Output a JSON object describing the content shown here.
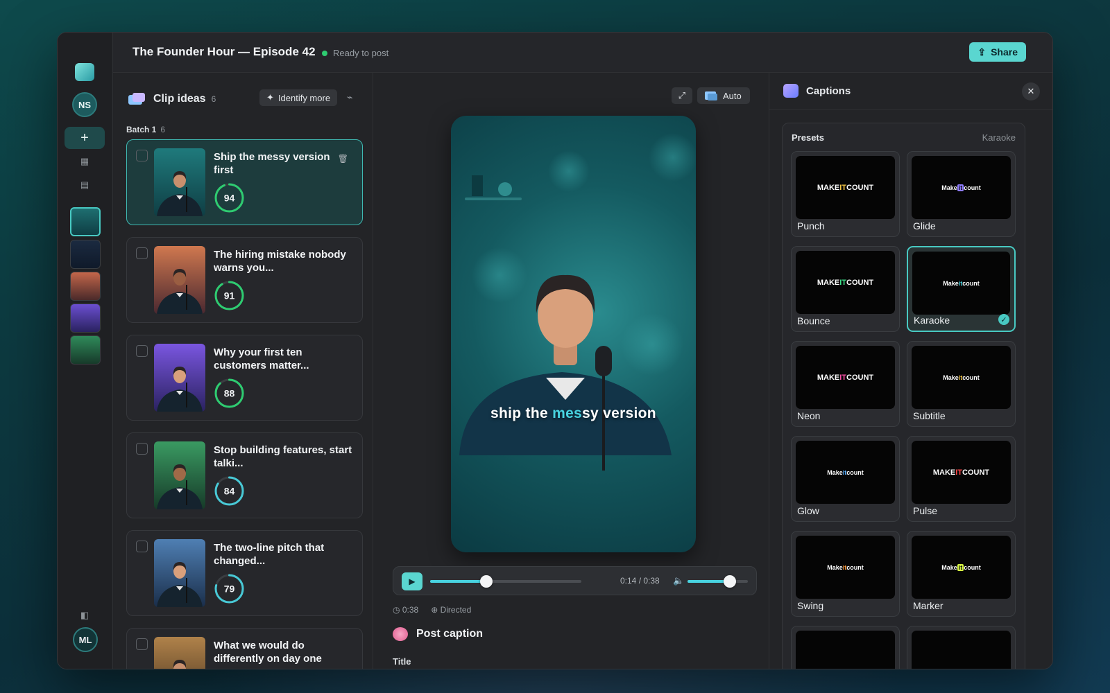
{
  "window": {
    "title": "The Founder Hour — Episode 42",
    "status": "Ready to post",
    "share_label": "Share"
  },
  "rail": {
    "workspace_initials": "NS",
    "user_initials": "ML",
    "add_label": "+"
  },
  "clips": {
    "title": "Clip ideas",
    "count": "6",
    "identify_label": "Identify more",
    "batch_label": "Batch 1",
    "batch_count": "6",
    "items": [
      {
        "title": "Ship the messy version first",
        "score": 94,
        "score_text": "94",
        "selected": true,
        "ring_color": "#2ecc71"
      },
      {
        "title": "The hiring mistake nobody warns you...",
        "score": 91,
        "score_text": "91",
        "selected": false,
        "ring_color": "#2ecc71"
      },
      {
        "title": "Why your first ten customers matter...",
        "score": 88,
        "score_text": "88",
        "selected": false,
        "ring_color": "#2ecc71"
      },
      {
        "title": "Stop building features, start talki...",
        "score": 84,
        "score_text": "84",
        "selected": false,
        "ring_color": "#48c9d6"
      },
      {
        "title": "The two-line pitch that changed...",
        "score": 79,
        "score_text": "79",
        "selected": false,
        "ring_color": "#48c9d6"
      },
      {
        "title": "What we would do differently on day one",
        "score": null,
        "score_text": "",
        "selected": false,
        "ring_color": "#48c9d6"
      }
    ]
  },
  "stage": {
    "auto_label": "Auto",
    "caption_before": "ship the ",
    "caption_highlight": "mes",
    "caption_after": "sy version",
    "time": "0:14 / 0:38",
    "progress": 0.37,
    "volume": 0.7,
    "duration": "0:38",
    "mode": "Directed",
    "post_caption_label": "Post caption",
    "title_label": "Title"
  },
  "captions": {
    "title": "Captions",
    "presets_label": "Presets",
    "current": "Karaoke",
    "presets": [
      {
        "name": "Punch",
        "preview_a": "MAKE ",
        "preview_b": "IT",
        "preview_c": " COUNT",
        "accent": "#f6c744",
        "selected": false
      },
      {
        "name": "Glide",
        "preview_a": "Make ",
        "preview_b": "it",
        "preview_c": " count",
        "accent": "#8e7cff",
        "selected": false
      },
      {
        "name": "Bounce",
        "preview_a": "MAKE ",
        "preview_b": "IT",
        "preview_c": " COUNT",
        "accent": "#3fe08a",
        "selected": false
      },
      {
        "name": "Karaoke",
        "preview_a": "Make ",
        "preview_b": "it",
        "preview_c": " count",
        "accent": "#48d3e0",
        "selected": true
      },
      {
        "name": "Neon",
        "preview_a": "MAKE ",
        "preview_b": "IT",
        "preview_c": " COUNT",
        "accent": "#ff4fa8",
        "selected": false
      },
      {
        "name": "Subtitle",
        "preview_a": "Make ",
        "preview_b": "it",
        "preview_c": " count",
        "accent": "#f6c744",
        "selected": false
      },
      {
        "name": "Glow",
        "preview_a": "Make ",
        "preview_b": "it",
        "preview_c": " count",
        "accent": "#5ab0ff",
        "selected": false
      },
      {
        "name": "Pulse",
        "preview_a": "MAKE ",
        "preview_b": "IT",
        "preview_c": " COUNT",
        "accent": "#ff4646",
        "selected": false
      },
      {
        "name": "Swing",
        "preview_a": "Make ",
        "preview_b": "it",
        "preview_c": " count",
        "accent": "#ff9a3c",
        "selected": false
      },
      {
        "name": "Marker",
        "preview_a": "Make ",
        "preview_b": "it",
        "preview_c": " count",
        "accent": "#d7f542",
        "selected": false
      }
    ]
  },
  "colors": {
    "accent": "#5ad6d0",
    "ready": "#2ecc71"
  }
}
